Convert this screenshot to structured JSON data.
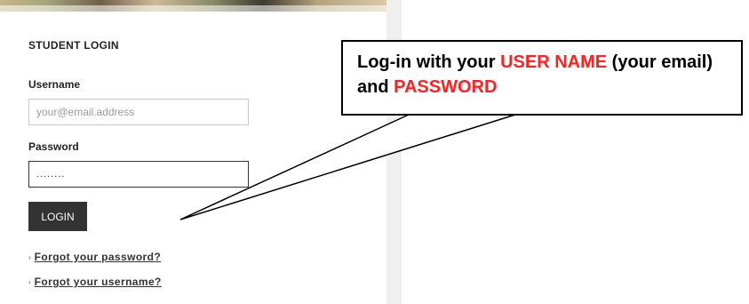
{
  "login": {
    "heading": "STUDENT LOGIN",
    "username_label": "Username",
    "username_placeholder": "your@email.address",
    "password_label": "Password",
    "password_value": "........",
    "login_button": "LOGIN",
    "forgot_password": "Forgot your password?",
    "forgot_username": "Forgot your username?"
  },
  "callout": {
    "text_1": "Log-in with your ",
    "text_2": "USER NAME",
    "text_3": " (your email) and ",
    "text_4": "PASSWORD",
    "highlight_color": "#ff2020"
  },
  "icons": {
    "link_arrow": "›"
  }
}
